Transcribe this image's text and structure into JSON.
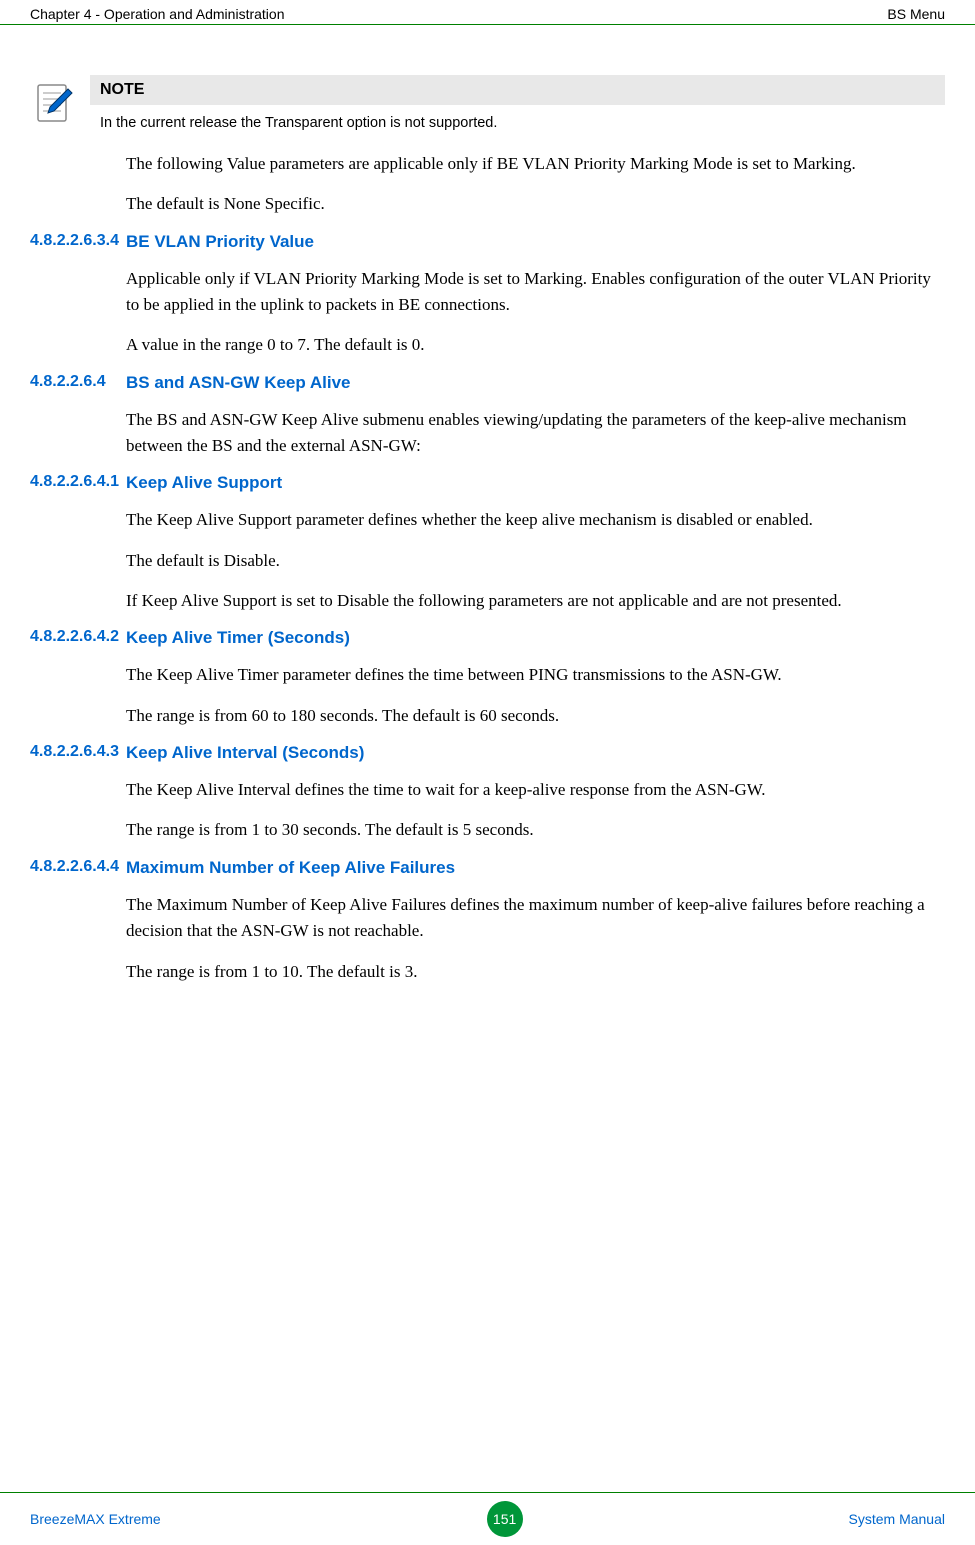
{
  "header": {
    "left": "Chapter 4 - Operation and Administration",
    "right": "BS Menu"
  },
  "note": {
    "title": "NOTE",
    "text": "In the current release the Transparent option is not supported."
  },
  "intro_paragraphs": [
    "The following Value parameters are applicable only if BE VLAN Priority Marking Mode is set to Marking.",
    "The default is None Specific."
  ],
  "sections": [
    {
      "num": "4.8.2.2.6.3.4",
      "title": "BE VLAN Priority Value",
      "paragraphs": [
        "Applicable only if VLAN Priority Marking Mode is set to Marking. Enables configuration of the outer VLAN Priority to be applied in the uplink to packets in BE connections.",
        "A value in the range 0 to 7. The default is 0."
      ]
    },
    {
      "num": "4.8.2.2.6.4",
      "title": "BS and ASN-GW Keep Alive",
      "paragraphs": [
        "The BS and ASN-GW Keep Alive submenu enables viewing/updating the parameters of the keep-alive mechanism between the BS and the external ASN-GW:"
      ]
    },
    {
      "num": "4.8.2.2.6.4.1",
      "title": "Keep Alive Support",
      "paragraphs": [
        "The Keep Alive Support parameter defines whether the keep alive mechanism is disabled or enabled.",
        "The default is Disable.",
        "If Keep Alive Support is set to Disable the following parameters are not applicable and are not presented."
      ]
    },
    {
      "num": "4.8.2.2.6.4.2",
      "title": "Keep Alive Timer (Seconds)",
      "paragraphs": [
        "The Keep Alive Timer parameter defines the time between PING transmissions to the ASN-GW.",
        "The range is from 60 to 180 seconds. The default is 60 seconds."
      ]
    },
    {
      "num": "4.8.2.2.6.4.3",
      "title": "Keep Alive Interval (Seconds)",
      "paragraphs": [
        "The Keep Alive Interval defines the time to wait for a keep-alive response from the ASN-GW.",
        "The range is from 1 to 30 seconds. The default is 5 seconds."
      ]
    },
    {
      "num": "4.8.2.2.6.4.4",
      "title": "Maximum Number of Keep Alive Failures",
      "paragraphs": [
        "The Maximum Number of Keep Alive Failures defines the maximum number of keep-alive failures before reaching a decision that the ASN-GW is not reachable.",
        "The range is from 1 to 10. The default is 3."
      ]
    }
  ],
  "footer": {
    "left": "BreezeMAX Extreme",
    "page": "151",
    "right": "System Manual"
  }
}
